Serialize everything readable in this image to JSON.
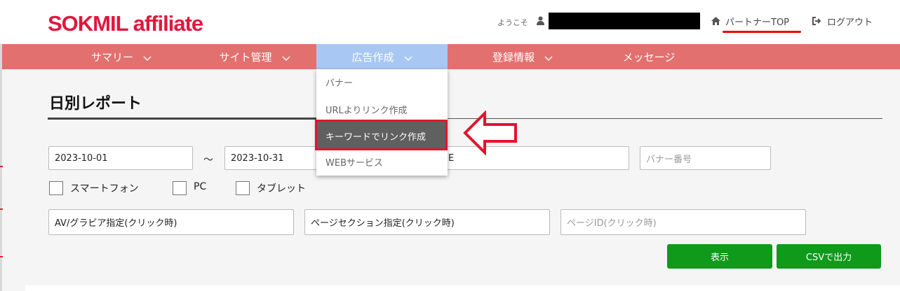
{
  "header": {
    "logo": "SOKMIL affiliate",
    "welcome": "ようこそ",
    "partner_top": "パートナーTOP",
    "logout": "ログアウト"
  },
  "nav": {
    "items": [
      {
        "label": "サマリー"
      },
      {
        "label": "サイト管理"
      },
      {
        "label": "広告作成"
      },
      {
        "label": "登録情報"
      },
      {
        "label": "メッセージ"
      }
    ]
  },
  "dropdown": {
    "items": [
      "バナー",
      "URLよりリンク作成",
      "キーワードでリンク作成",
      "WEBサービス"
    ],
    "highlighted_index": 2
  },
  "page": {
    "title": "日別レポート"
  },
  "filters": {
    "date_from": "2023-10-01",
    "date_separator": "～",
    "date_to": "2023-10-31",
    "site_field_partial": "E",
    "banner_number_placeholder": "バナー番号",
    "checkboxes": [
      "スマートフォン",
      "PC",
      "タブレット"
    ],
    "av_gravure": "AV/グラビア指定(クリック時)",
    "page_section": "ページセクション指定(クリック時)",
    "page_id_placeholder": "ページID(クリック時)"
  },
  "buttons": {
    "show": "表示",
    "csv": "CSVで出力"
  },
  "colors": {
    "brand": "#e0173d",
    "nav_bg": "#e2706f",
    "nav_active": "#a8c8f3",
    "button": "#0f9a1b",
    "annotation": "#e0152d"
  }
}
